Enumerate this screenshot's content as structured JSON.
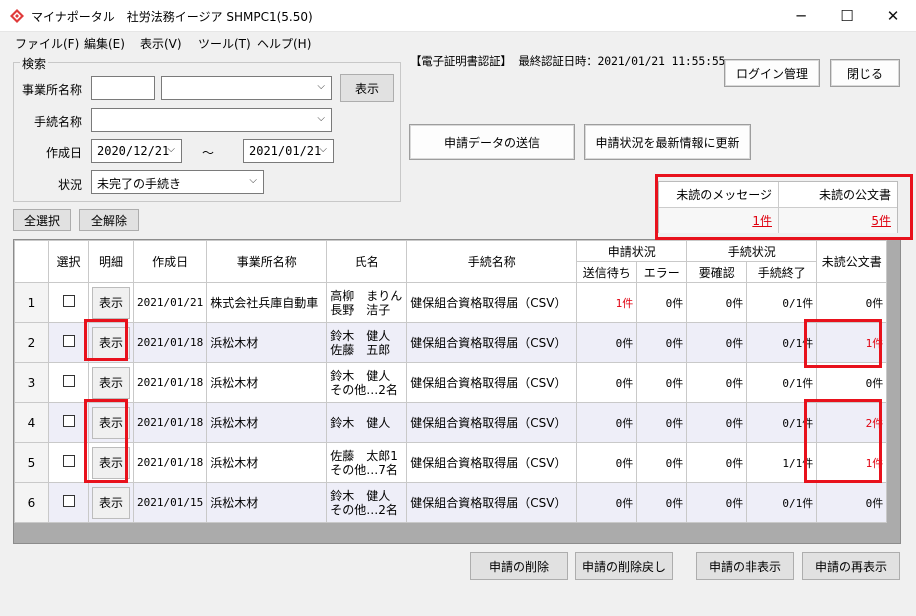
{
  "window": {
    "title": "マイナポータル　社労法務イージア SHMPC1(5.50)",
    "minimize": "─",
    "maximize": "☐",
    "close": "✕"
  },
  "menu": [
    "ファイル(F)",
    "編集(E)",
    "表示(V)",
    "ツール(T)",
    "ヘルプ(H)"
  ],
  "search": {
    "legend": "検索",
    "office_label": "事業所名称",
    "office_code": "",
    "office_name": "",
    "show_button": "表示",
    "procedure_label": "手続名称",
    "procedure_value": "",
    "date_label": "作成日",
    "date_from": "2020/12/21",
    "date_sep": "～",
    "date_to": "2021/01/21",
    "status_label": "状況",
    "status_value": "未完了の手続き"
  },
  "select_all": "全選択",
  "deselect_all": "全解除",
  "cert_info": "【電子証明書認証】 最終認証日時：2021/01/21 11:55:55",
  "login_button": "ログイン管理",
  "close_button": "閉じる",
  "send_button": "申請データの送信",
  "update_button": "申請状況を最新情報に更新",
  "unread": {
    "messages_label": "未読のメッセージ",
    "messages_value": "1件",
    "docs_label": "未読の公文書",
    "docs_value": "5件"
  },
  "grid": {
    "headers": {
      "select": "選択",
      "detail": "明細",
      "created": "作成日",
      "office": "事業所名称",
      "name": "氏名",
      "procedure": "手続名称",
      "app_status": "申請状況",
      "waiting": "送信待ち",
      "error": "エラー",
      "proc_status": "手続状況",
      "confirm": "要確認",
      "done": "手続終了",
      "unread_docs": "未読公文書"
    },
    "rows": [
      {
        "no": "1",
        "detail": "表示",
        "created": "2021/01/21",
        "office": "株式会社兵庫自動車",
        "name1": "高柳　まりん",
        "name2": "長野　洁子",
        "procedure": "健保組合資格取得届（CSV）",
        "waiting": "1件",
        "error": "0件",
        "confirm": "0件",
        "done": "0/1件",
        "unread": "0件"
      },
      {
        "no": "2",
        "detail": "表示",
        "created": "2021/01/18",
        "office": "浜松木材",
        "name1": "鈴木　健人",
        "name2": "佐藤　五郎",
        "procedure": "健保組合資格取得届（CSV）",
        "waiting": "0件",
        "error": "0件",
        "confirm": "0件",
        "done": "0/1件",
        "unread": "1件"
      },
      {
        "no": "3",
        "detail": "表示",
        "created": "2021/01/18",
        "office": "浜松木材",
        "name1": "鈴木　健人",
        "name2": "その他…2名",
        "procedure": "健保組合資格取得届（CSV）",
        "waiting": "0件",
        "error": "0件",
        "confirm": "0件",
        "done": "0/1件",
        "unread": "0件"
      },
      {
        "no": "4",
        "detail": "表示",
        "created": "2021/01/18",
        "office": "浜松木材",
        "name1": "鈴木　健人",
        "name2": "",
        "procedure": "健保組合資格取得届（CSV）",
        "waiting": "0件",
        "error": "0件",
        "confirm": "0件",
        "done": "0/1件",
        "unread": "2件"
      },
      {
        "no": "5",
        "detail": "表示",
        "created": "2021/01/18",
        "office": "浜松木材",
        "name1": "佐藤　太郎1",
        "name2": "その他…7名",
        "procedure": "健保組合資格取得届（CSV）",
        "waiting": "0件",
        "error": "0件",
        "confirm": "0件",
        "done": "1/1件",
        "unread": "1件"
      },
      {
        "no": "6",
        "detail": "表示",
        "created": "2021/01/15",
        "office": "浜松木材",
        "name1": "鈴木　健人",
        "name2": "その他…2名",
        "procedure": "健保組合資格取得届（CSV）",
        "waiting": "0件",
        "error": "0件",
        "confirm": "0件",
        "done": "0/1件",
        "unread": "0件"
      }
    ]
  },
  "bottom_buttons": {
    "delete": "申請の削除",
    "undo_delete": "申請の削除戻し",
    "hide": "申請の非表示",
    "reshow": "申請の再表示"
  },
  "colors": {
    "highlight_frame": "#e8111c",
    "red_text": "#e0000f",
    "alt_row": "#eeeef8"
  }
}
